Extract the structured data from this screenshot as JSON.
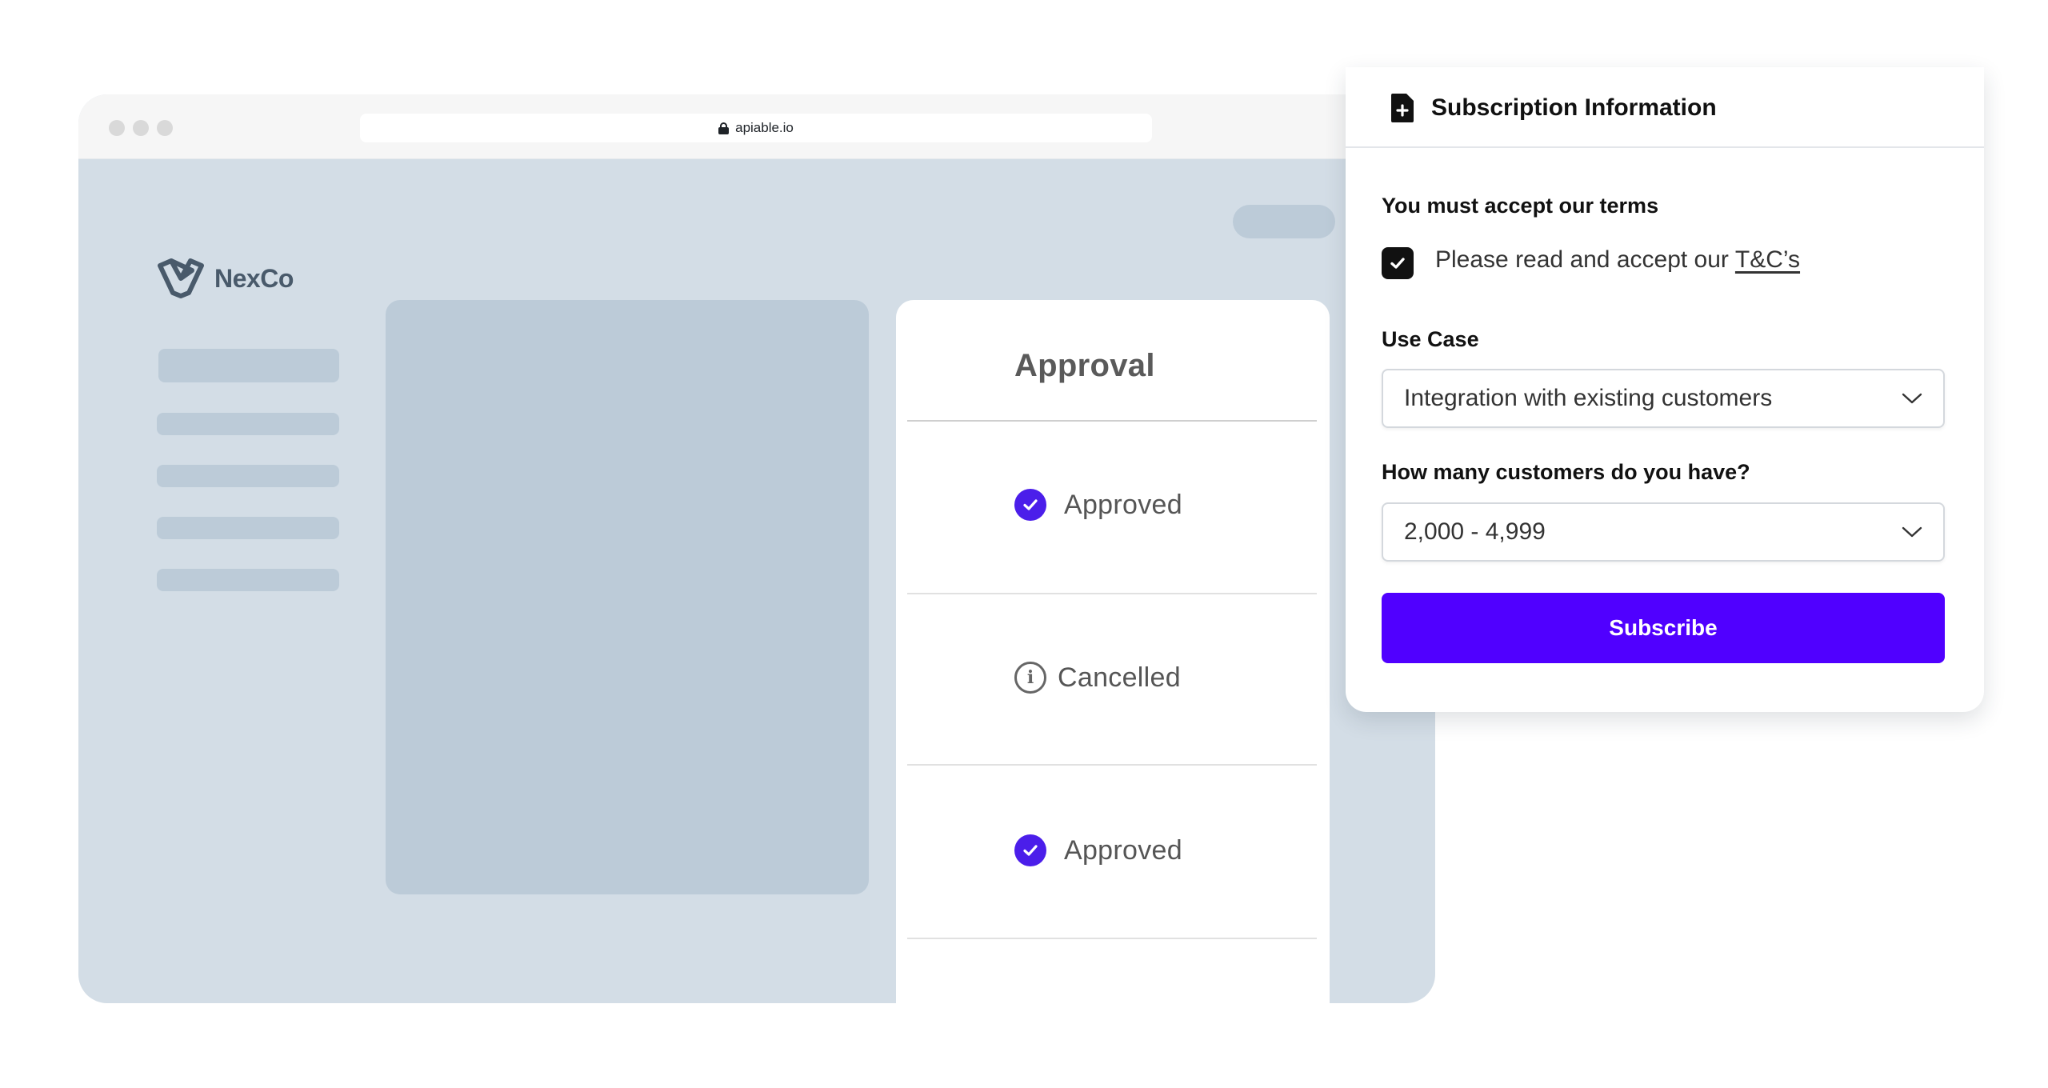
{
  "browser": {
    "url": "apiable.io"
  },
  "app": {
    "logo_text": "NexCo"
  },
  "approval": {
    "title": "Approval",
    "rows": [
      {
        "status": "Approved",
        "icon": "check-circle-icon"
      },
      {
        "status": "Cancelled",
        "icon": "info-icon"
      },
      {
        "status": "Approved",
        "icon": "check-circle-icon"
      }
    ]
  },
  "subscription": {
    "title": "Subscription Information",
    "terms_label": "You must accept our terms",
    "terms_text": "Please read and accept our",
    "terms_link": "T&C’s",
    "terms_checked": true,
    "use_case_label": "Use Case",
    "use_case_value": "Integration with existing customers",
    "customers_label": "How many customers do you have?",
    "customers_value": "2,000 - 4,999",
    "subscribe_label": "Subscribe"
  },
  "colors": {
    "accent": "#5000ff",
    "approved_icon": "#4b1eea",
    "page_bg": "#d3dde6",
    "skeleton": "#bccbd8"
  }
}
